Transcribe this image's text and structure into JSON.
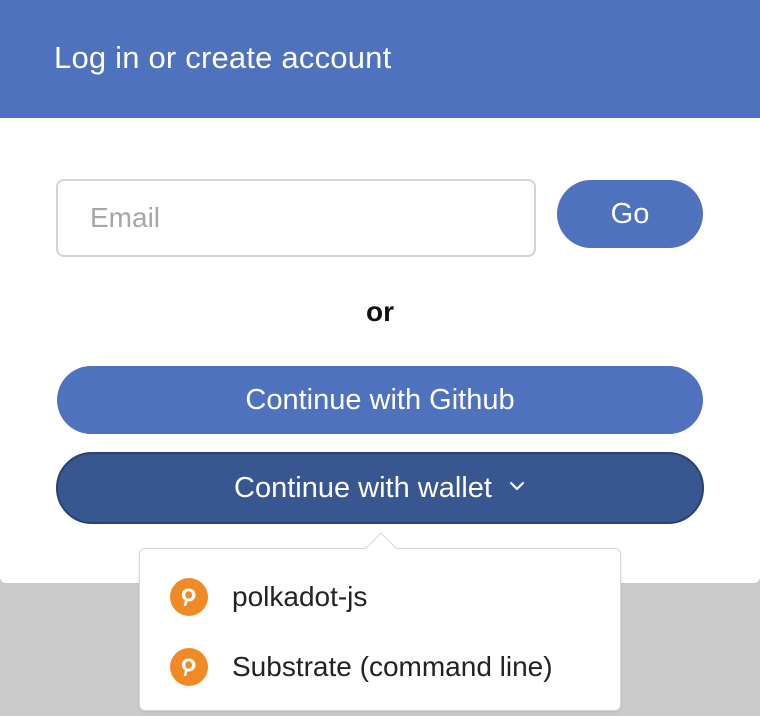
{
  "modal": {
    "title": "Log in or create account"
  },
  "email": {
    "placeholder": "Email",
    "value": ""
  },
  "go_button": {
    "label": "Go"
  },
  "divider": {
    "label": "or"
  },
  "github_button": {
    "label": "Continue with Github"
  },
  "wallet_button": {
    "label": "Continue with wallet",
    "icon": "chevron-down-icon"
  },
  "wallet_menu": {
    "items": [
      {
        "label": "polkadot-js",
        "icon": "polkadot-icon"
      },
      {
        "label": "Substrate (command line)",
        "icon": "polkadot-icon"
      }
    ]
  },
  "colors": {
    "primary": "#4e72bd",
    "primary_dark": "#38568f",
    "wallet_icon": "#f08a24",
    "backdrop": "#cccccc"
  }
}
